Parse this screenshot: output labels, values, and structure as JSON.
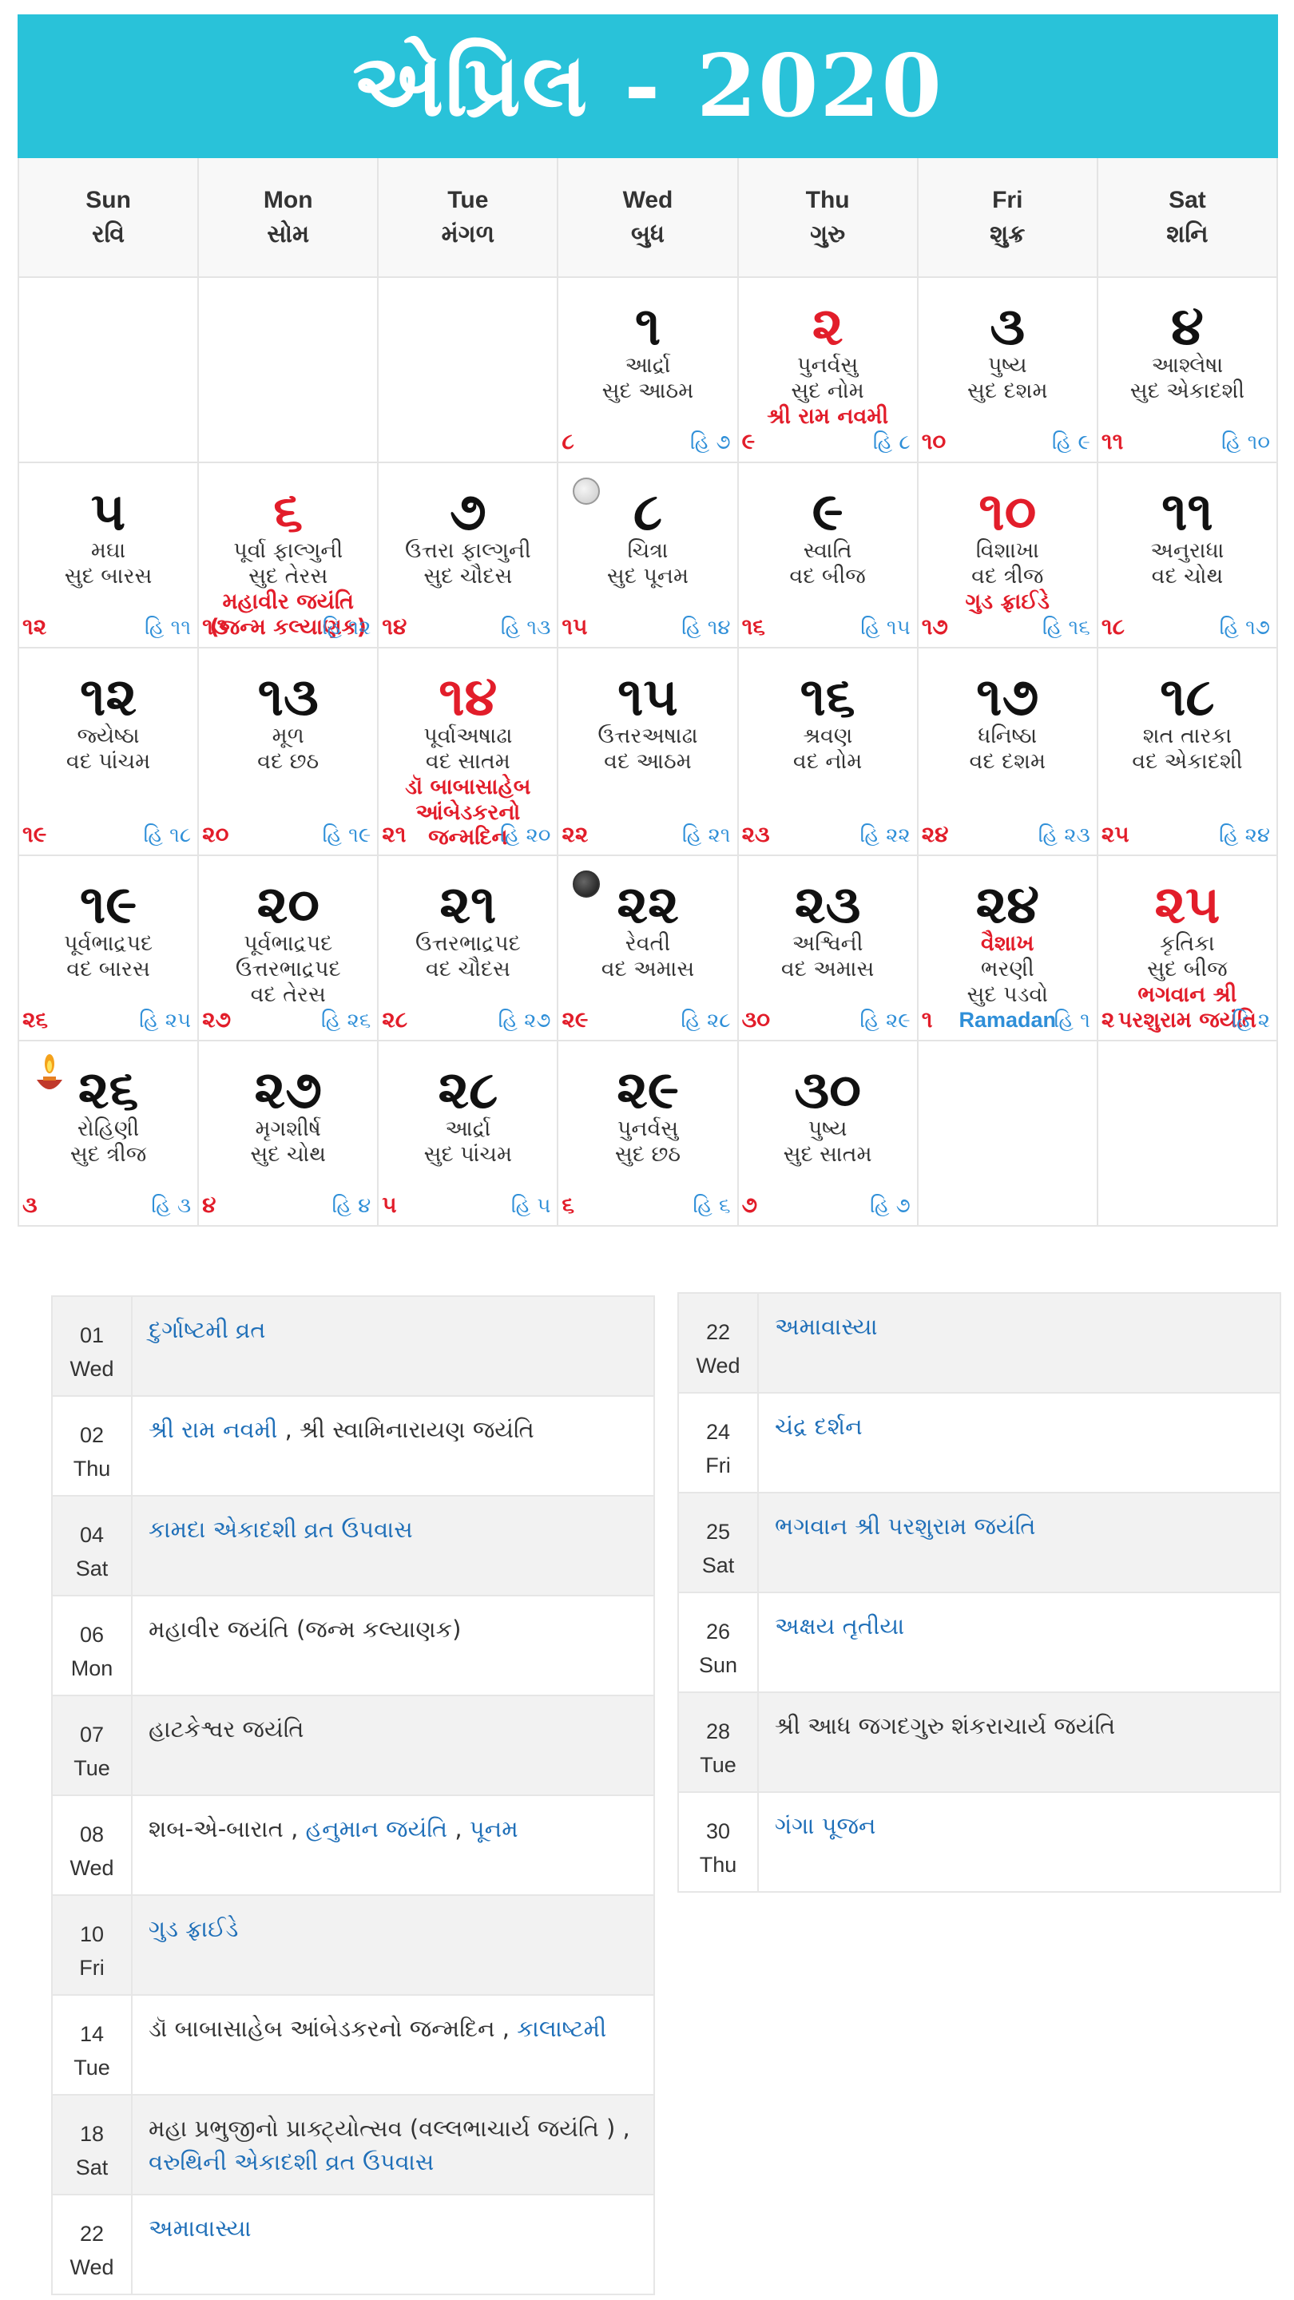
{
  "title": {
    "month": "એપ્રિલ",
    "separator": "-",
    "year": "2020"
  },
  "weekdays": [
    {
      "en": "Sun",
      "gu": "રવિ"
    },
    {
      "en": "Mon",
      "gu": "સોમ"
    },
    {
      "en": "Tue",
      "gu": "મંગળ"
    },
    {
      "en": "Wed",
      "gu": "બુધ"
    },
    {
      "en": "Thu",
      "gu": "ગુરુ"
    },
    {
      "en": "Fri",
      "gu": "શુક્ર"
    },
    {
      "en": "Sat",
      "gu": "શનિ"
    }
  ],
  "days": [
    {
      "day": "૧",
      "lines": [
        "આર્દ્રા",
        "સુદ આઠમ"
      ],
      "cn": "૮",
      "hn": "હિ ૭"
    },
    {
      "day": "૨",
      "dayColor": "red",
      "lines": [
        "પુનર્વસુ",
        "સુદ નોમ"
      ],
      "event": "શ્રી રામ નવમી",
      "cn": "૯",
      "hn": "હિ ૮"
    },
    {
      "day": "૩",
      "lines": [
        "પુષ્ય",
        "સુદ દશમ"
      ],
      "cn": "૧૦",
      "hn": "હિ ૯"
    },
    {
      "day": "૪",
      "lines": [
        "આશ્લેષા",
        "સુદ એકાદશી"
      ],
      "cn": "૧૧",
      "hn": "હિ ૧૦"
    },
    {
      "day": "૫",
      "lines": [
        "મઘા",
        "સુદ બારસ"
      ],
      "cn": "૧૨",
      "hn": "હિ ૧૧"
    },
    {
      "day": "૬",
      "dayColor": "red",
      "lines": [
        "પૂર્વા ફાલ્ગુની",
        "સુદ તેરસ"
      ],
      "event": "મહાવીર જયંતિ",
      "event2": "(જન્મ કલ્યાણક)",
      "cn": "૧૩",
      "hn": "હિ ૧૨"
    },
    {
      "day": "૭",
      "lines": [
        "ઉત્તરા ફાલ્ગુની",
        "સુદ ચૌદસ"
      ],
      "cn": "૧૪",
      "hn": "હિ ૧૩"
    },
    {
      "day": "૮",
      "lines": [
        "ચિત્રા",
        "સુદ પૂનમ"
      ],
      "cn": "૧૫",
      "hn": "હિ ૧૪",
      "moon": "full"
    },
    {
      "day": "૯",
      "lines": [
        "સ્વાતિ",
        "વદ બીજ"
      ],
      "cn": "૧૬",
      "hn": "હિ ૧૫"
    },
    {
      "day": "૧૦",
      "dayColor": "red",
      "lines": [
        "વિશાખા",
        "વદ ત્રીજ"
      ],
      "event": "ગુડ ફ્રાઈડે",
      "cn": "૧૭",
      "hn": "હિ ૧૬"
    },
    {
      "day": "૧૧",
      "lines": [
        "અનુરાધા",
        "વદ ચોથ"
      ],
      "cn": "૧૮",
      "hn": "હિ ૧૭"
    },
    {
      "day": "૧૨",
      "lines": [
        "જ્યેષ્ઠા",
        "વદ પાંચમ"
      ],
      "cn": "૧૯",
      "hn": "હિ ૧૮"
    },
    {
      "day": "૧૩",
      "lines": [
        "મૂળ",
        "વદ છઠ"
      ],
      "cn": "૨૦",
      "hn": "હિ ૧૯"
    },
    {
      "day": "૧૪",
      "dayColor": "red",
      "lines": [
        "પૂર્વાઅષાઢા",
        "વદ સાતમ"
      ],
      "event": "ડૉ બાબાસાહેબ",
      "event2": "આંબેડકરનો",
      "event3": "જન્મદિન",
      "cn": "૨૧",
      "hn": "હિ ૨૦"
    },
    {
      "day": "૧૫",
      "lines": [
        "ઉત્તરઅષાઢા",
        "વદ આઠમ"
      ],
      "cn": "૨૨",
      "hn": "હિ ૨૧"
    },
    {
      "day": "૧૬",
      "lines": [
        "શ્રવણ",
        "વદ નોમ"
      ],
      "cn": "૨૩",
      "hn": "હિ ૨૨"
    },
    {
      "day": "૧૭",
      "lines": [
        "ધનિષ્ઠા",
        "વદ દશમ"
      ],
      "cn": "૨૪",
      "hn": "હિ ૨૩"
    },
    {
      "day": "૧૮",
      "lines": [
        "શત તારકા",
        "વદ એકાદશી"
      ],
      "cn": "૨૫",
      "hn": "હિ ૨૪"
    },
    {
      "day": "૧૯",
      "lines": [
        "પૂર્વભાદ્રપદ",
        "વદ બારસ"
      ],
      "cn": "૨૬",
      "hn": "હિ ૨૫"
    },
    {
      "day": "૨૦",
      "lines": [
        "પૂર્વભાદ્રપદ",
        "ઉત્તરભાદ્રપદ",
        "વદ તેરસ"
      ],
      "cn": "૨૭",
      "hn": "હિ ૨૬"
    },
    {
      "day": "૨૧",
      "lines": [
        "ઉત્તરભાદ્રપદ",
        "વદ ચૌદસ"
      ],
      "cn": "૨૮",
      "hn": "હિ ૨૭"
    },
    {
      "day": "૨૨",
      "lines": [
        "રેવતી",
        "વદ અમાસ"
      ],
      "cn": "૨૯",
      "hn": "હિ ૨૮",
      "moon": "new"
    },
    {
      "day": "૨૩",
      "lines": [
        "અશ્વિની",
        "વદ અમાસ"
      ],
      "cn": "૩૦",
      "hn": "હિ ૨૯"
    },
    {
      "day": "૨૪",
      "lines": [
        "વૈશાખ",
        "ભરણી",
        "સુદ પડવો"
      ],
      "firstRed": true,
      "extraBlue": "Ramadan",
      "cn": "૧",
      "hn": "હિ ૧"
    },
    {
      "day": "૨૫",
      "dayColor": "red",
      "lines": [
        "કૃતિકા",
        "સુદ બીજ"
      ],
      "event": "ભગવાન શ્રી",
      "event2": "પરશુરામ જયંતિ",
      "cn": "૨",
      "hn": "હિ ૨"
    },
    {
      "day": "૨૬",
      "lines": [
        "રોહિણી",
        "સુદ ત્રીજ"
      ],
      "cn": "૩",
      "hn": "હિ ૩",
      "lamp": true
    },
    {
      "day": "૨૭",
      "lines": [
        "મૃગશીર્ષ",
        "સુદ ચોથ"
      ],
      "cn": "૪",
      "hn": "હિ ૪"
    },
    {
      "day": "૨૮",
      "lines": [
        "આર્દ્રા",
        "સુદ પાંચમ"
      ],
      "cn": "૫",
      "hn": "હિ ૫"
    },
    {
      "day": "૨૯",
      "lines": [
        "પુનર્વસુ",
        "સુદ છઠ"
      ],
      "cn": "૬",
      "hn": "હિ ૬"
    },
    {
      "day": "૩૦",
      "lines": [
        "પુષ્ય",
        "સુદ સાતમ"
      ],
      "cn": "૭",
      "hn": "હિ ૭"
    }
  ],
  "leading_blanks": 3,
  "trailing_blanks": 2,
  "events_left": [
    {
      "date": "01",
      "dow": "Wed",
      "parts": [
        {
          "t": "દુર્ગાષ્ટમી વ્રત",
          "link": true
        }
      ]
    },
    {
      "date": "02",
      "dow": "Thu",
      "parts": [
        {
          "t": "શ્રી રામ નવમી",
          "link": true
        },
        {
          "t": " , "
        },
        {
          "t": "શ્રી સ્વામિનારાયણ જયંતિ"
        }
      ]
    },
    {
      "date": "04",
      "dow": "Sat",
      "parts": [
        {
          "t": "કામદા એકાદશી વ્રત ઉપવાસ",
          "link": true
        }
      ]
    },
    {
      "date": "06",
      "dow": "Mon",
      "parts": [
        {
          "t": "મહાવીર જયંતિ (જન્મ કલ્યાણક)"
        }
      ]
    },
    {
      "date": "07",
      "dow": "Tue",
      "parts": [
        {
          "t": "હાટકેશ્વર જયંતિ"
        }
      ]
    },
    {
      "date": "08",
      "dow": "Wed",
      "parts": [
        {
          "t": "શબ-એ-બારાત , "
        },
        {
          "t": "હનુમાન જયંતિ",
          "link": true
        },
        {
          "t": " , "
        },
        {
          "t": "પૂનમ",
          "link": true
        }
      ]
    },
    {
      "date": "10",
      "dow": "Fri",
      "parts": [
        {
          "t": "ગુડ ફ્રાઈડે",
          "link": true
        }
      ]
    },
    {
      "date": "14",
      "dow": "Tue",
      "parts": [
        {
          "t": "ડૉ બાબાસાહેબ આંબેડકરનો જન્મદિન , "
        },
        {
          "t": "કાલાષ્ટમી",
          "link": true
        }
      ]
    },
    {
      "date": "18",
      "dow": "Sat",
      "parts": [
        {
          "t": "મહા પ્રભુજીનો પ્રાક્ટ્યોત્સવ (વલ્લભાચાર્ય જયંતિ ) , "
        },
        {
          "t": "વરુથિની એકાદશી વ્રત ઉપવાસ",
          "link": true
        }
      ]
    },
    {
      "date": "22",
      "dow": "Wed",
      "parts": [
        {
          "t": "અમાવાસ્યા",
          "link": true
        }
      ]
    }
  ],
  "events_right": [
    {
      "date": "22",
      "dow": "Wed",
      "parts": [
        {
          "t": "અમાવાસ્યા",
          "link": true
        }
      ]
    },
    {
      "date": "24",
      "dow": "Fri",
      "parts": [
        {
          "t": "ચંદ્ર દર્શન",
          "link": true
        }
      ]
    },
    {
      "date": "25",
      "dow": "Sat",
      "parts": [
        {
          "t": "ભગવાન શ્રી પરશુરામ જયંતિ",
          "link": true
        }
      ]
    },
    {
      "date": "26",
      "dow": "Sun",
      "parts": [
        {
          "t": "અક્ષય તૃતીયા",
          "link": true
        }
      ]
    },
    {
      "date": "28",
      "dow": "Tue",
      "parts": [
        {
          "t": "શ્રી આધ જગદગુરુ શંકરાચાર્ય જયંતિ"
        }
      ]
    },
    {
      "date": "30",
      "dow": "Thu",
      "parts": [
        {
          "t": "ગંગા પૂજન",
          "link": true
        }
      ]
    }
  ],
  "colors": {
    "header": "#29c2d9",
    "red": "#e21d2a",
    "blue": "#2f8fd8",
    "link": "#1f6fb8"
  }
}
